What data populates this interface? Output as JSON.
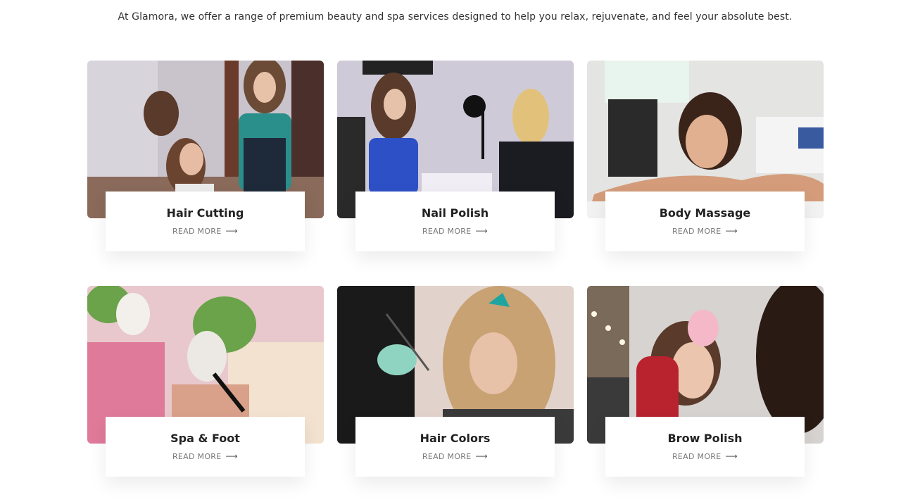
{
  "intro": "At Glamora, we offer a range of premium beauty and spa services designed to help you relax, rejuvenate, and feel your absolute best.",
  "services": [
    {
      "title": "Hair Cutting",
      "read_more": "READ MORE",
      "icon": "arrow-right-icon"
    },
    {
      "title": "Nail Polish",
      "read_more": "READ MORE",
      "icon": "arrow-right-icon"
    },
    {
      "title": "Body Massage",
      "read_more": "READ MORE",
      "icon": "arrow-right-icon"
    },
    {
      "title": "Spa & Foot",
      "read_more": "READ MORE",
      "icon": "arrow-right-icon"
    },
    {
      "title": "Hair Colors",
      "read_more": "READ MORE",
      "icon": "arrow-right-icon"
    },
    {
      "title": "Brow Polish",
      "read_more": "READ MORE",
      "icon": "arrow-right-icon"
    }
  ]
}
